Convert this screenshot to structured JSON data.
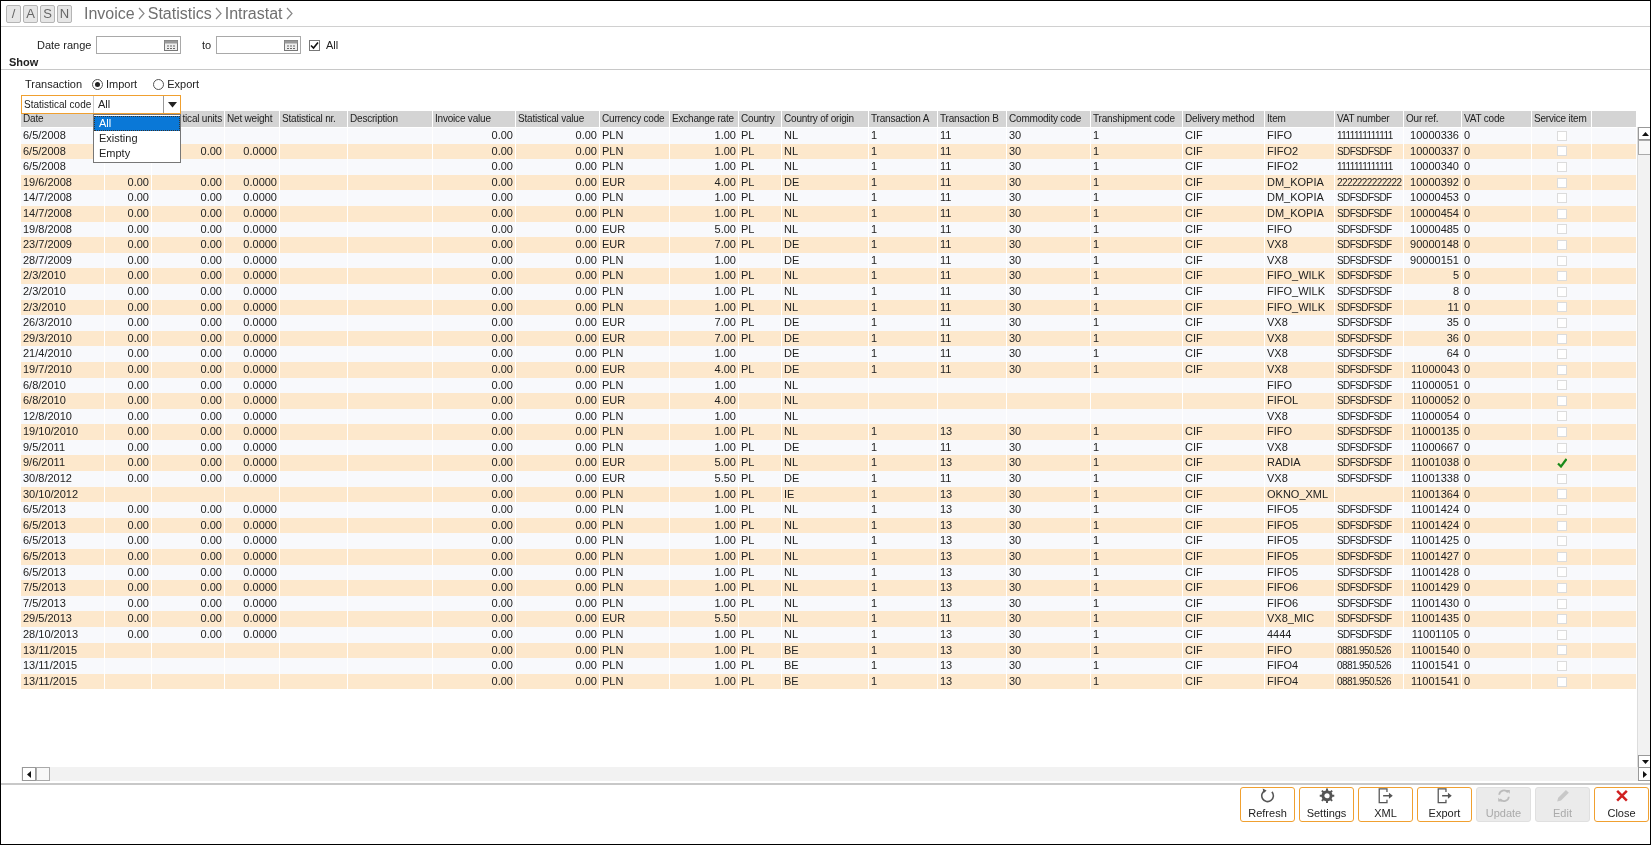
{
  "breadcrumb": {
    "mode_buttons": [
      "/",
      "A",
      "S",
      "N"
    ],
    "path": [
      "Invoice",
      "Statistics",
      "Intrastat"
    ]
  },
  "filters": {
    "date_range": {
      "label": "Date range",
      "to_label": "to",
      "all": {
        "label": "All",
        "checked": true
      }
    },
    "show_heading": "Show",
    "transaction": {
      "label": "Transaction",
      "options": [
        {
          "label": "Import",
          "selected": true
        },
        {
          "label": "Export",
          "selected": false
        }
      ]
    },
    "statistical_code": {
      "label": "Statistical code",
      "value": "All",
      "expanded": true,
      "options": [
        {
          "label": "All",
          "selected": true
        },
        {
          "label": "Existing",
          "selected": false
        },
        {
          "label": "Empty",
          "selected": false
        }
      ]
    }
  },
  "table": {
    "columns": [
      "Date",
      null,
      "tical units",
      "Net weight",
      "Statistical nr.",
      "Description",
      "Invoice value",
      "Statistical value",
      "Currency code",
      "Exchange rate",
      "Country",
      "Country of origin",
      "Transaction A",
      "Transaction B",
      "Commodity code",
      "Transhipment code",
      "Delivery method",
      "Item",
      "VAT number",
      "Our ref.",
      "VAT code",
      "Service item"
    ],
    "rows": [
      {
        "cells": [
          "6/5/2008",
          null,
          null,
          null,
          null,
          null,
          "0.00",
          "0.00",
          "PLN",
          "1.00",
          "PL",
          "NL",
          "1",
          "11",
          "30",
          "1",
          "CIF",
          "FIFO",
          "1111111111111",
          "10000336",
          "0"
        ],
        "service_item": false
      },
      {
        "cells": [
          "6/5/2008",
          null,
          "0.00",
          "0.0000",
          null,
          null,
          "0.00",
          "0.00",
          "PLN",
          "1.00",
          "PL",
          "NL",
          "1",
          "11",
          "30",
          "1",
          "CIF",
          "FIFO2",
          "SDFSDFSDF",
          "10000337",
          "0"
        ],
        "service_item": false
      },
      {
        "cells": [
          "6/5/2008",
          null,
          null,
          null,
          null,
          null,
          "0.00",
          "0.00",
          "PLN",
          "1.00",
          "PL",
          "NL",
          "1",
          "11",
          "30",
          "1",
          "CIF",
          "FIFO2",
          "1111111111111",
          "10000340",
          "0"
        ],
        "service_item": false
      },
      {
        "cells": [
          "19/6/2008",
          "0.00",
          "0.00",
          "0.0000",
          null,
          null,
          "0.00",
          "0.00",
          "EUR",
          "4.00",
          "PL",
          "DE",
          "1",
          "11",
          "30",
          "1",
          "CIF",
          "DM_KOPIA",
          "2222222222222",
          "10000392",
          "0"
        ],
        "service_item": false
      },
      {
        "cells": [
          "14/7/2008",
          "0.00",
          "0.00",
          "0.0000",
          null,
          null,
          "0.00",
          "0.00",
          "PLN",
          "1.00",
          "PL",
          "NL",
          "1",
          "11",
          "30",
          "1",
          "CIF",
          "DM_KOPIA",
          "SDFSDFSDF",
          "10000453",
          "0"
        ],
        "service_item": false
      },
      {
        "cells": [
          "14/7/2008",
          "0.00",
          "0.00",
          "0.0000",
          null,
          null,
          "0.00",
          "0.00",
          "PLN",
          "1.00",
          "PL",
          "NL",
          "1",
          "11",
          "30",
          "1",
          "CIF",
          "DM_KOPIA",
          "SDFSDFSDF",
          "10000454",
          "0"
        ],
        "service_item": false
      },
      {
        "cells": [
          "19/8/2008",
          "0.00",
          "0.00",
          "0.0000",
          null,
          null,
          "0.00",
          "0.00",
          "EUR",
          "5.00",
          "PL",
          "NL",
          "1",
          "11",
          "30",
          "1",
          "CIF",
          "FIFO",
          "SDFSDFSDF",
          "10000485",
          "0"
        ],
        "service_item": false
      },
      {
        "cells": [
          "23/7/2009",
          "0.00",
          "0.00",
          "0.0000",
          null,
          null,
          "0.00",
          "0.00",
          "EUR",
          "7.00",
          "PL",
          "DE",
          "1",
          "11",
          "30",
          "1",
          "CIF",
          "VX8",
          "SDFSDFSDF",
          "90000148",
          "0"
        ],
        "service_item": false
      },
      {
        "cells": [
          "28/7/2009",
          "0.00",
          "0.00",
          "0.0000",
          null,
          null,
          "0.00",
          "0.00",
          "PLN",
          "1.00",
          null,
          "DE",
          "1",
          "11",
          "30",
          "1",
          "CIF",
          "VX8",
          "SDFSDFSDF",
          "90000151",
          "0"
        ],
        "service_item": false
      },
      {
        "cells": [
          "2/3/2010",
          "0.00",
          "0.00",
          "0.0000",
          null,
          null,
          "0.00",
          "0.00",
          "PLN",
          "1.00",
          "PL",
          "NL",
          "1",
          "11",
          "30",
          "1",
          "CIF",
          "FIFO_WILK",
          "SDFSDFSDF",
          "5",
          "0"
        ],
        "service_item": false
      },
      {
        "cells": [
          "2/3/2010",
          "0.00",
          "0.00",
          "0.0000",
          null,
          null,
          "0.00",
          "0.00",
          "PLN",
          "1.00",
          "PL",
          "NL",
          "1",
          "11",
          "30",
          "1",
          "CIF",
          "FIFO_WILK",
          "SDFSDFSDF",
          "8",
          "0"
        ],
        "service_item": false
      },
      {
        "cells": [
          "2/3/2010",
          "0.00",
          "0.00",
          "0.0000",
          null,
          null,
          "0.00",
          "0.00",
          "PLN",
          "1.00",
          "PL",
          "NL",
          "1",
          "11",
          "30",
          "1",
          "CIF",
          "FIFO_WILK",
          "SDFSDFSDF",
          "11",
          "0"
        ],
        "service_item": false
      },
      {
        "cells": [
          "26/3/2010",
          "0.00",
          "0.00",
          "0.0000",
          null,
          null,
          "0.00",
          "0.00",
          "EUR",
          "7.00",
          "PL",
          "DE",
          "1",
          "11",
          "30",
          "1",
          "CIF",
          "VX8",
          "SDFSDFSDF",
          "35",
          "0"
        ],
        "service_item": false
      },
      {
        "cells": [
          "29/3/2010",
          "0.00",
          "0.00",
          "0.0000",
          null,
          null,
          "0.00",
          "0.00",
          "EUR",
          "7.00",
          "PL",
          "DE",
          "1",
          "11",
          "30",
          "1",
          "CIF",
          "VX8",
          "SDFSDFSDF",
          "36",
          "0"
        ],
        "service_item": false
      },
      {
        "cells": [
          "21/4/2010",
          "0.00",
          "0.00",
          "0.0000",
          null,
          null,
          "0.00",
          "0.00",
          "PLN",
          "1.00",
          null,
          "DE",
          "1",
          "11",
          "30",
          "1",
          "CIF",
          "VX8",
          "SDFSDFSDF",
          "64",
          "0"
        ],
        "service_item": false
      },
      {
        "cells": [
          "19/7/2010",
          "0.00",
          "0.00",
          "0.0000",
          null,
          null,
          "0.00",
          "0.00",
          "EUR",
          "4.00",
          "PL",
          "DE",
          "1",
          "11",
          "30",
          "1",
          "CIF",
          "VX8",
          "SDFSDFSDF",
          "11000043",
          "0"
        ],
        "service_item": false
      },
      {
        "cells": [
          "6/8/2010",
          "0.00",
          "0.00",
          "0.0000",
          null,
          null,
          "0.00",
          "0.00",
          "PLN",
          "1.00",
          null,
          "NL",
          null,
          null,
          null,
          null,
          null,
          "FIFO",
          "SDFSDFSDF",
          "11000051",
          "0"
        ],
        "service_item": false
      },
      {
        "cells": [
          "6/8/2010",
          "0.00",
          "0.00",
          "0.0000",
          null,
          null,
          "0.00",
          "0.00",
          "EUR",
          "4.00",
          null,
          "NL",
          null,
          null,
          null,
          null,
          null,
          "FIFOL",
          "SDFSDFSDF",
          "11000052",
          "0"
        ],
        "service_item": false
      },
      {
        "cells": [
          "12/8/2010",
          "0.00",
          "0.00",
          "0.0000",
          null,
          null,
          "0.00",
          "0.00",
          "PLN",
          "1.00",
          null,
          "NL",
          null,
          null,
          null,
          null,
          null,
          "VX8",
          "SDFSDFSDF",
          "11000054",
          "0"
        ],
        "service_item": false
      },
      {
        "cells": [
          "19/10/2010",
          "0.00",
          "0.00",
          "0.0000",
          null,
          null,
          "0.00",
          "0.00",
          "PLN",
          "1.00",
          "PL",
          "NL",
          "1",
          "13",
          "30",
          "1",
          "CIF",
          "FIFO",
          "SDFSDFSDF",
          "11000135",
          "0"
        ],
        "service_item": false
      },
      {
        "cells": [
          "9/5/2011",
          "0.00",
          "0.00",
          "0.0000",
          null,
          null,
          "0.00",
          "0.00",
          "PLN",
          "1.00",
          "PL",
          "DE",
          "1",
          "11",
          "30",
          "1",
          "CIF",
          "VX8",
          "SDFSDFSDF",
          "11000667",
          "0"
        ],
        "service_item": false
      },
      {
        "cells": [
          "9/6/2011",
          "0.00",
          "0.00",
          "0.0000",
          null,
          null,
          "0.00",
          "0.00",
          "EUR",
          "5.00",
          "PL",
          "NL",
          "1",
          "13",
          "30",
          "1",
          "CIF",
          "RADIA",
          "SDFSDFSDF",
          "11001038",
          "0"
        ],
        "service_item": true
      },
      {
        "cells": [
          "30/8/2012",
          "0.00",
          "0.00",
          "0.0000",
          null,
          null,
          "0.00",
          "0.00",
          "EUR",
          "5.50",
          "PL",
          "DE",
          "1",
          "11",
          "30",
          "1",
          "CIF",
          "VX8",
          "SDFSDFSDF",
          "11001338",
          "0"
        ],
        "service_item": false
      },
      {
        "cells": [
          "30/10/2012",
          null,
          null,
          null,
          null,
          null,
          "0.00",
          "0.00",
          "PLN",
          "1.00",
          "PL",
          "IE",
          "1",
          "13",
          "30",
          "1",
          "CIF",
          "OKNO_XML",
          null,
          "11001364",
          "0"
        ],
        "service_item": false
      },
      {
        "cells": [
          "6/5/2013",
          "0.00",
          "0.00",
          "0.0000",
          null,
          null,
          "0.00",
          "0.00",
          "PLN",
          "1.00",
          "PL",
          "NL",
          "1",
          "13",
          "30",
          "1",
          "CIF",
          "FIFO5",
          "SDFSDFSDF",
          "11001424",
          "0"
        ],
        "service_item": false
      },
      {
        "cells": [
          "6/5/2013",
          "0.00",
          "0.00",
          "0.0000",
          null,
          null,
          "0.00",
          "0.00",
          "PLN",
          "1.00",
          "PL",
          "NL",
          "1",
          "13",
          "30",
          "1",
          "CIF",
          "FIFO5",
          "SDFSDFSDF",
          "11001424",
          "0"
        ],
        "service_item": false
      },
      {
        "cells": [
          "6/5/2013",
          "0.00",
          "0.00",
          "0.0000",
          null,
          null,
          "0.00",
          "0.00",
          "PLN",
          "1.00",
          "PL",
          "NL",
          "1",
          "13",
          "30",
          "1",
          "CIF",
          "FIFO5",
          "SDFSDFSDF",
          "11001425",
          "0"
        ],
        "service_item": false
      },
      {
        "cells": [
          "6/5/2013",
          "0.00",
          "0.00",
          "0.0000",
          null,
          null,
          "0.00",
          "0.00",
          "PLN",
          "1.00",
          "PL",
          "NL",
          "1",
          "13",
          "30",
          "1",
          "CIF",
          "FIFO5",
          "SDFSDFSDF",
          "11001427",
          "0"
        ],
        "service_item": false
      },
      {
        "cells": [
          "6/5/2013",
          "0.00",
          "0.00",
          "0.0000",
          null,
          null,
          "0.00",
          "0.00",
          "PLN",
          "1.00",
          "PL",
          "NL",
          "1",
          "13",
          "30",
          "1",
          "CIF",
          "FIFO5",
          "SDFSDFSDF",
          "11001428",
          "0"
        ],
        "service_item": false
      },
      {
        "cells": [
          "7/5/2013",
          "0.00",
          "0.00",
          "0.0000",
          null,
          null,
          "0.00",
          "0.00",
          "PLN",
          "1.00",
          "PL",
          "NL",
          "1",
          "13",
          "30",
          "1",
          "CIF",
          "FIFO6",
          "SDFSDFSDF",
          "11001429",
          "0"
        ],
        "service_item": false
      },
      {
        "cells": [
          "7/5/2013",
          "0.00",
          "0.00",
          "0.0000",
          null,
          null,
          "0.00",
          "0.00",
          "PLN",
          "1.00",
          "PL",
          "NL",
          "1",
          "13",
          "30",
          "1",
          "CIF",
          "FIFO6",
          "SDFSDFSDF",
          "11001430",
          "0"
        ],
        "service_item": false
      },
      {
        "cells": [
          "29/5/2013",
          "0.00",
          "0.00",
          "0.0000",
          null,
          null,
          "0.00",
          "0.00",
          "EUR",
          "5.50",
          null,
          "NL",
          "1",
          "11",
          "30",
          "1",
          "CIF",
          "VX8_MIC",
          "SDFSDFSDF",
          "11001435",
          "0"
        ],
        "service_item": false
      },
      {
        "cells": [
          "28/10/2013",
          "0.00",
          "0.00",
          "0.0000",
          null,
          null,
          "0.00",
          "0.00",
          "PLN",
          "1.00",
          "PL",
          "NL",
          "1",
          "13",
          "30",
          "1",
          "CIF",
          "4444",
          "SDFSDFSDF",
          "11001105",
          "0"
        ],
        "service_item": false
      },
      {
        "cells": [
          "13/11/2015",
          null,
          null,
          null,
          null,
          null,
          "0.00",
          "0.00",
          "PLN",
          "1.00",
          "PL",
          "BE",
          "1",
          "13",
          "30",
          "1",
          "CIF",
          "FIFO",
          "0881.950.526",
          "11001540",
          "0"
        ],
        "service_item": false
      },
      {
        "cells": [
          "13/11/2015",
          null,
          null,
          null,
          null,
          null,
          "0.00",
          "0.00",
          "PLN",
          "1.00",
          "PL",
          "BE",
          "1",
          "13",
          "30",
          "1",
          "CIF",
          "FIFO4",
          "0881.950.526",
          "11001541",
          "0"
        ],
        "service_item": false
      },
      {
        "cells": [
          "13/11/2015",
          null,
          null,
          null,
          null,
          null,
          "0.00",
          "0.00",
          "PLN",
          "1.00",
          "PL",
          "BE",
          "1",
          "13",
          "30",
          "1",
          "CIF",
          "FIFO4",
          "0881.950.526",
          "11001541",
          "0"
        ],
        "service_item": false
      }
    ]
  },
  "buttons": [
    {
      "label": "Refresh",
      "kind": "refresh",
      "disabled": false
    },
    {
      "label": "Settings",
      "kind": "settings",
      "disabled": false
    },
    {
      "label": "XML",
      "kind": "xml",
      "disabled": false
    },
    {
      "label": "Export",
      "kind": "export",
      "disabled": false
    },
    {
      "label": "Update",
      "kind": "update",
      "disabled": true
    },
    {
      "label": "Edit",
      "kind": "edit",
      "disabled": true
    },
    {
      "label": "Close",
      "kind": "close",
      "disabled": false
    }
  ]
}
